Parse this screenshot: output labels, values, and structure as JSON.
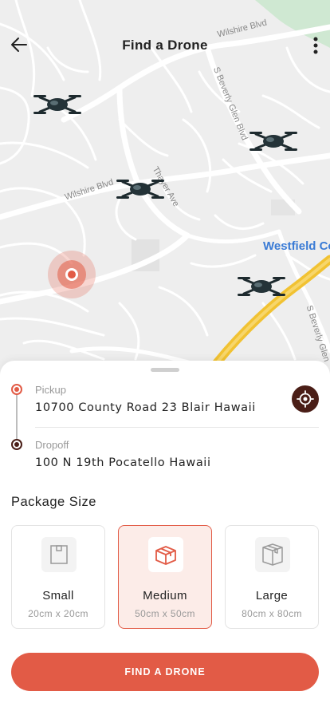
{
  "header": {
    "title": "Find a Drone",
    "back_icon": "arrow-left-icon",
    "menu_icon": "more-vertical-icon"
  },
  "map": {
    "labels": {
      "wilshire_top": "Wilshire Blvd",
      "wilshire_mid": "Wilshire Blvd",
      "beverly_glen_top": "S Beverly Glen Blvd",
      "beverly_glen_bottom": "S Beverly Glen",
      "thayer": "Thayer Ave",
      "westfield": "Westfield Co"
    },
    "drone_count": 4
  },
  "route": {
    "pickup_label": "Pickup",
    "pickup_address": "10700 County Road 23 Blair Hawaii",
    "dropoff_label": "Dropoff",
    "dropoff_address": "100 N 19th Pocatello Hawaii"
  },
  "package": {
    "section_title": "Package Size",
    "sizes": [
      {
        "name": "Small",
        "dimensions": "20cm x 20cm",
        "selected": false
      },
      {
        "name": "Medium",
        "dimensions": "50cm x 50cm",
        "selected": true
      },
      {
        "name": "Large",
        "dimensions": "80cm x 80cm",
        "selected": false
      }
    ]
  },
  "cta": {
    "label": "FIND A DRONE"
  },
  "colors": {
    "accent": "#e25b46",
    "dark_accent": "#4a1e17",
    "selected_card_bg": "#fcece8",
    "map_bg": "#eeeeee",
    "highway": "#f4c542",
    "park": "#cfe8d2"
  }
}
